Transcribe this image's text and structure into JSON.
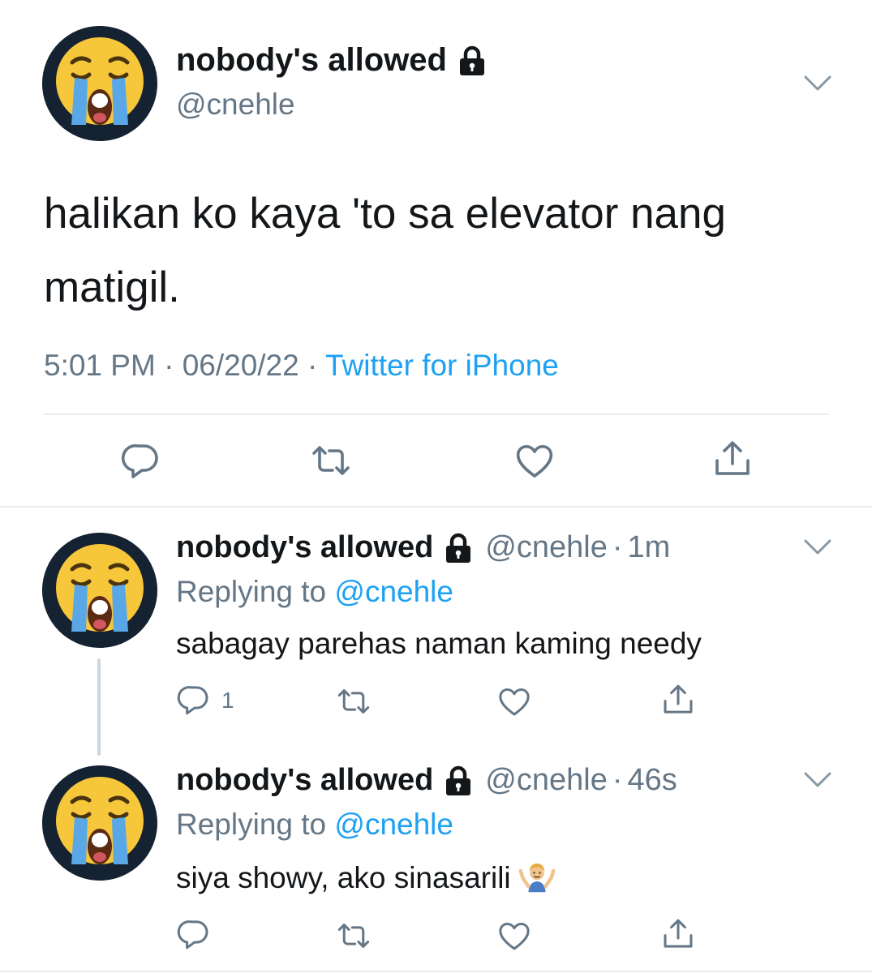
{
  "main_tweet": {
    "display_name": "nobody's allowed",
    "handle": "@cnehle",
    "text": "halikan ko kaya 'to sa elevator nang matigil.",
    "time": "5:01 PM",
    "separator": "·",
    "date": "06/20/22",
    "source": "Twitter for iPhone"
  },
  "replies": [
    {
      "display_name": "nobody's allowed",
      "handle": "@cnehle",
      "separator": "·",
      "time": "1m",
      "replying_prefix": "Replying to",
      "replying_to": "@cnehle",
      "text": "sabagay parehas naman kaming needy",
      "reply_count": "1"
    },
    {
      "display_name": "nobody's allowed",
      "handle": "@cnehle",
      "separator": "·",
      "time": "46s",
      "replying_prefix": "Replying to",
      "replying_to": "@cnehle",
      "text": "siya showy, ako sinasarili",
      "emoji": "🤷‍♂️"
    }
  ],
  "icons": {
    "avatar": "loudly-crying-face-icon",
    "lock": "lock-icon",
    "menu": "chevron-down-icon",
    "reply": "reply-icon",
    "retweet": "retweet-icon",
    "like": "heart-icon",
    "share": "share-icon"
  },
  "colors": {
    "link": "#1da1f2",
    "secondary_text": "#657786",
    "primary_text": "#14171a",
    "divider": "#e6ecf0",
    "avatar_bg": "#152231"
  }
}
